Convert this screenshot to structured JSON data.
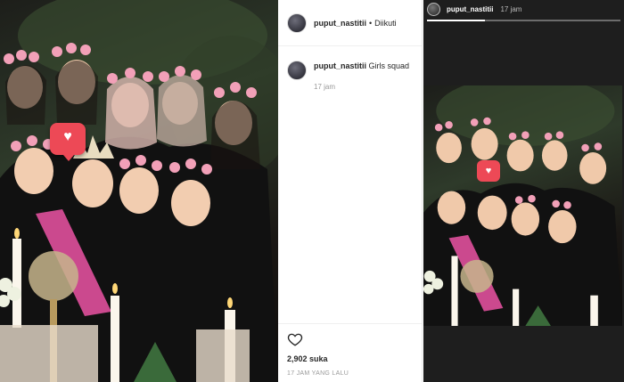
{
  "post": {
    "username": "puput_nastitii",
    "follow_status": "Diikuti",
    "caption": "Girls squad",
    "caption_time": "17 jam",
    "likes": "2,902 suka",
    "timestamp": "17 JAM YANG LALU"
  },
  "story": {
    "username": "puput_nastitii",
    "time": "17 jam"
  },
  "icons": {
    "like": "heart-icon",
    "like_outline": "heart-outline-icon"
  },
  "colors": {
    "like_badge": "#ed4956",
    "secondary_text": "#999999"
  }
}
